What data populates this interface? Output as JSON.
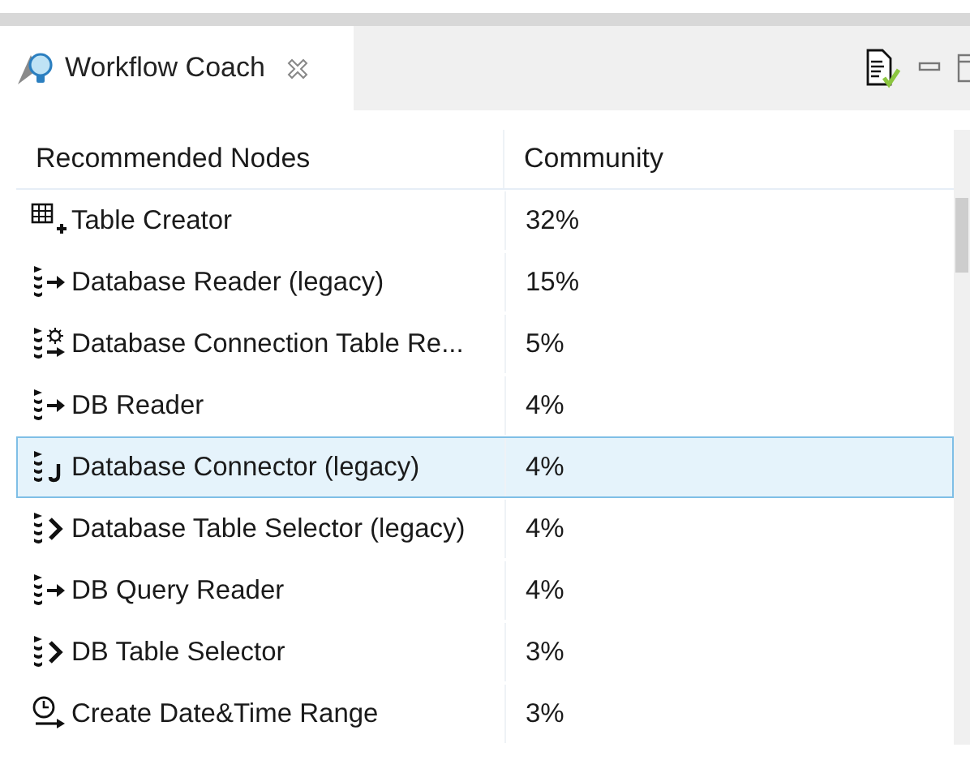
{
  "view_tab": {
    "title": "Workflow Coach",
    "selected": true
  },
  "table": {
    "columns": [
      "Recommended Nodes",
      "Community"
    ],
    "rows": [
      {
        "kind": "table-creator",
        "name": "Table Creator",
        "share": "32%",
        "selected": false
      },
      {
        "kind": "db-reader",
        "name": "Database Reader (legacy)",
        "share": "15%",
        "selected": false
      },
      {
        "kind": "db-config",
        "name": "Database Connection Table Re...",
        "share": "5%",
        "selected": false
      },
      {
        "kind": "db-reader",
        "name": "DB Reader",
        "share": "4%",
        "selected": false
      },
      {
        "kind": "db-connector",
        "name": "Database Connector (legacy)",
        "share": "4%",
        "selected": true
      },
      {
        "kind": "db-selector",
        "name": "Database Table Selector (legacy)",
        "share": "4%",
        "selected": false
      },
      {
        "kind": "db-reader",
        "name": "DB Query Reader",
        "share": "4%",
        "selected": false
      },
      {
        "kind": "db-selector",
        "name": "DB Table Selector",
        "share": "3%",
        "selected": false
      },
      {
        "kind": "clock",
        "name": "Create Date&Time Range",
        "share": "3%",
        "selected": false
      }
    ]
  }
}
